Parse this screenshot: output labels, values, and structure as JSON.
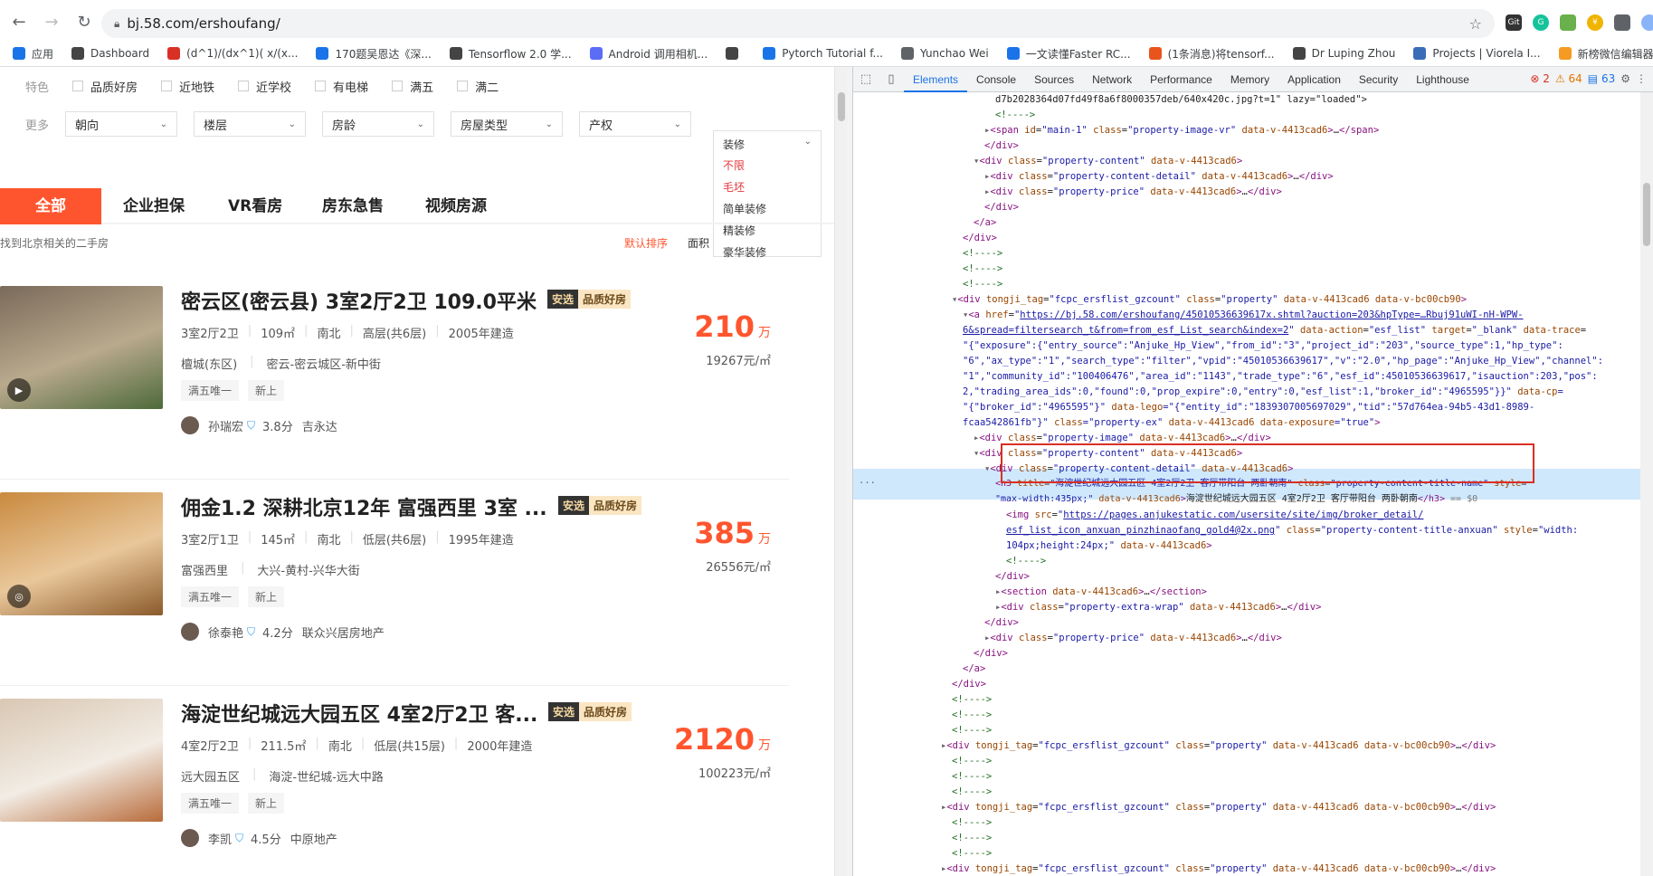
{
  "browser": {
    "url": "bj.58.com/ershoufang/",
    "bookmarks": [
      {
        "label": "应用",
        "color": "#1a73e8"
      },
      {
        "label": "Dashboard",
        "color": "#444444"
      },
      {
        "label": "(d^1)/(dx^1)( x/(x...",
        "color": "#d93025"
      },
      {
        "label": "170题吴恩达《深...",
        "color": "#1a73e8"
      },
      {
        "label": "Tensorflow 2.0 学...",
        "color": "#444444"
      },
      {
        "label": "Android 调用相机...",
        "color": "#5b6cf6"
      },
      {
        "label": "",
        "color": "#444444"
      },
      {
        "label": "Pytorch Tutorial f...",
        "color": "#1a73e8"
      },
      {
        "label": "Yunchao Wei",
        "color": "#5f6368"
      },
      {
        "label": "一文读懂Faster RC...",
        "color": "#1a73e8"
      },
      {
        "label": "(1条消息)将tensorf...",
        "color": "#e8541c"
      },
      {
        "label": "Dr Luping Zhou",
        "color": "#444444"
      },
      {
        "label": "Projects | Viorela I...",
        "color": "#3b6cb7"
      },
      {
        "label": "新榜微信编辑器—...",
        "color": "#f59b23"
      }
    ]
  },
  "filters": {
    "feature_label": "特色",
    "features": [
      "品质好房",
      "近地铁",
      "近学校",
      "有电梯",
      "满五",
      "满二"
    ],
    "more_label": "更多",
    "dropdowns": [
      "朝向",
      "楼层",
      "房龄",
      "房屋类型",
      "产权"
    ],
    "decoration": {
      "header": "装修",
      "options": [
        {
          "label": "不限",
          "highlight": true
        },
        {
          "label": "毛坯",
          "highlight": true
        },
        {
          "label": "简单装修",
          "highlight": false
        },
        {
          "label": "精装修",
          "highlight": false
        },
        {
          "label": "豪华装修",
          "highlight": false
        }
      ]
    }
  },
  "tabs": [
    "全部",
    "企业担保",
    "VR看房",
    "房东急售",
    "视频房源"
  ],
  "found_text": "找到北京相关的二手房",
  "sort_label": "默认排序",
  "area_label": "面积",
  "listings": [
    {
      "title": "密云区(密云县) 3室2厅2卫 109.0平米",
      "badge1": "安选",
      "badge2": "品质好房",
      "attrs": [
        "3室2厅2卫",
        "109㎡",
        "南北",
        "高层(共6层)",
        "2005年建造"
      ],
      "community": "檀城(东区)",
      "district": "密云-密云城区-新中街",
      "tags": [
        "满五唯一",
        "新上"
      ],
      "broker": "孙瑞宏",
      "score": "3.8分",
      "agency": "吉永达",
      "price": "210",
      "price_unit": "万",
      "unit_price": "19267元/㎡",
      "thumb_icon": "play-icon",
      "thumb_colors": [
        "#7a6a5a",
        "#b9a98d",
        "#4d6a3a"
      ]
    },
    {
      "title": "佣金1.2 深耕北京12年 富强西里 3室 ...",
      "badge1": "安选",
      "badge2": "品质好房",
      "attrs": [
        "3室2厅1卫",
        "145㎡",
        "南北",
        "低层(共6层)",
        "1995年建造"
      ],
      "community": "富强西里",
      "district": "大兴-黄村-兴华大街",
      "tags": [
        "满五唯一",
        "新上"
      ],
      "broker": "徐泰艳",
      "score": "4.2分",
      "agency": "联众兴居房地产",
      "price": "385",
      "price_unit": "万",
      "unit_price": "26556元/㎡",
      "thumb_icon": "vr-icon",
      "thumb_colors": [
        "#c98a3f",
        "#e9c79a",
        "#8b5a2b"
      ]
    },
    {
      "title": "海淀世纪城远大园五区 4室2厅2卫 客...",
      "badge1": "安选",
      "badge2": "品质好房",
      "attrs": [
        "4室2厅2卫",
        "211.5㎡",
        "南北",
        "低层(共15层)",
        "2000年建造"
      ],
      "community": "远大园五区",
      "district": "海淀-世纪城-远大中路",
      "tags": [
        "满五唯一",
        "新上"
      ],
      "broker": "李凯",
      "score": "4.5分",
      "agency": "中原地产",
      "price": "2120",
      "price_unit": "万",
      "unit_price": "100223元/㎡",
      "thumb_icon": "",
      "thumb_colors": [
        "#d9c7b3",
        "#f2ece4",
        "#b86b3a"
      ]
    }
  ],
  "devtools": {
    "tabs": [
      "Elements",
      "Console",
      "Sources",
      "Network",
      "Performance",
      "Memory",
      "Application",
      "Security",
      "Lighthouse"
    ],
    "active_tab": "Elements",
    "errors": "2",
    "warnings": "64",
    "infos": "63"
  }
}
